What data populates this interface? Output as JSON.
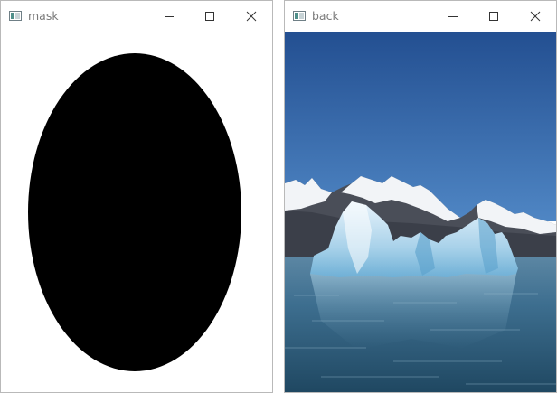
{
  "windows": {
    "mask": {
      "title": "mask",
      "icon": "opencv-window-icon",
      "controls": [
        "minimize-icon",
        "maximize-icon",
        "close-icon"
      ],
      "content": {
        "background_color": "#ffffff",
        "shape": "ellipse",
        "shape_color": "#000000"
      }
    },
    "back": {
      "title": "back",
      "icon": "opencv-window-icon",
      "controls": [
        "minimize-icon",
        "maximize-icon",
        "close-icon"
      ],
      "content": {
        "scene": "iceberg-with-snowy-mountains",
        "sky_color": "#2f5f9c",
        "water_color": "#2c5672"
      }
    }
  }
}
